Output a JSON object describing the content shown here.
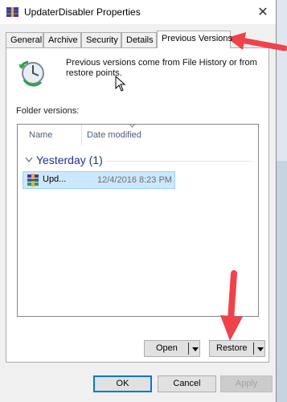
{
  "window": {
    "title": "UpdaterDisabler Properties",
    "close_glyph": "✕"
  },
  "tabs": [
    {
      "label": "General",
      "active": false
    },
    {
      "label": "Archive",
      "active": false
    },
    {
      "label": "Security",
      "active": false
    },
    {
      "label": "Details",
      "active": false
    },
    {
      "label": "Previous Versions",
      "active": true
    }
  ],
  "panel": {
    "info_text": "Previous versions come from File History or from restore points.",
    "folder_versions_label": "Folder versions:",
    "columns": [
      "Name",
      "Date modified"
    ],
    "group": {
      "label": "Yesterday (1)"
    },
    "files": [
      {
        "name": "Upd...",
        "date_modified": "12/4/2016 8:23 PM",
        "selected": true
      }
    ],
    "open_button": "Open",
    "restore_button": "Restore"
  },
  "footer": {
    "ok": "OK",
    "cancel": "Cancel",
    "apply": "Apply"
  },
  "colors": {
    "annotation_arrow": "#f0424a",
    "selection_fill": "#cce8ff",
    "group_header": "#1e3287"
  }
}
